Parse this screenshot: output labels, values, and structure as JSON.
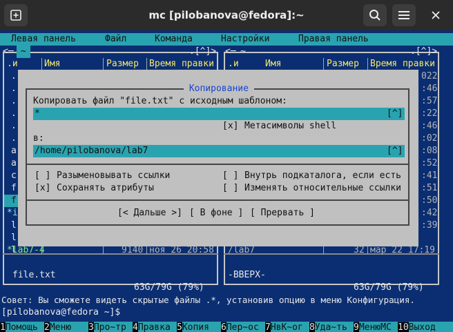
{
  "window": {
    "title": "mc [pilobanova@fedora]:~",
    "new_tab_icon": "new-tab-icon",
    "search_icon": "search-icon",
    "menu_icon": "hamburger-menu-icon",
    "close_icon": "close-icon"
  },
  "menubar": {
    "items": [
      "Левая панель",
      "Файл",
      "Команда",
      "Настройки",
      "Правая панель"
    ]
  },
  "left_panel": {
    "path": "~",
    "top_right": ".[^]>",
    "corner_left": "<─",
    "col_n": ".и",
    "col_name": "Имя",
    "col_size": "Размер",
    "col_mtime": "Время правки",
    "left_chars": [
      ".",
      ".",
      ".",
      ".",
      ".",
      ".",
      "a",
      "a",
      "c",
      "f",
      "f",
      "*i",
      "l",
      "l",
      "l"
    ],
    "last_row": {
      "name": "*lab7-4",
      "size": "9140",
      "mtime": "ноя 26 20:58"
    },
    "mini_status": "file.txt",
    "free_space": "63G/79G (79%)"
  },
  "right_panel": {
    "top_right": ".[^]>",
    "corner_left": "<─",
    "col_n": ".и",
    "col_name": "Имя",
    "col_size": "Размер",
    "col_mtime": "Время правки",
    "right_chars": [
      "022",
      ":46",
      ":57",
      ":22",
      ":46",
      ":02",
      ":08",
      ":52",
      ":41",
      ":51",
      ":50",
      ":42",
      ":39"
    ],
    "last_row": {
      "name": "/lab7",
      "size": "32",
      "mtime": "мар 22 17:19"
    },
    "mini_status": "-ВВЕРХ-",
    "free_space": "63G/79G (79%)"
  },
  "dialog": {
    "title": " Копирование ",
    "prompt": "Копировать файл \"file.txt\" с исходным шаблоном:",
    "source_value": "*",
    "history_btn": "[^]",
    "metachar_check": "[x]",
    "metachar_label": "Метасимволы shell",
    "dest_label": "в:",
    "dest_value": "/home/pilobanova/lab7",
    "opt1_check": "[ ]",
    "opt1_label": "Разыменовывать ссылки",
    "opt2_check": "[x]",
    "opt2_label": "Сохранять атрибуты",
    "opt3_check": "[ ]",
    "opt3_label": "Внутрь подкаталога, если есть",
    "opt4_check": "[ ]",
    "opt4_label": "Изменять относительные ссылки",
    "btn_continue": "[< Дальше >]",
    "btn_background": "[ В фоне ]",
    "btn_abort": "[ Прервать ]"
  },
  "hint": "Совет: Вы сможете видеть скрытые файлы .*, установив опцию в меню Конфигурация.",
  "prompt": "[pilobanova@fedora ~]$",
  "fkeys": [
    {
      "num": "1",
      "label": "Помощь"
    },
    {
      "num": "2",
      "label": "Меню"
    },
    {
      "num": "3",
      "label": "Про~тр"
    },
    {
      "num": "4",
      "label": "Правка"
    },
    {
      "num": "5",
      "label": "Копия"
    },
    {
      "num": "6",
      "label": "Пер~ос"
    },
    {
      "num": "7",
      "label": "НвК~ог"
    },
    {
      "num": "8",
      "label": "Уда~ть"
    },
    {
      "num": "9",
      "label": "МенюMC"
    },
    {
      "num": "10",
      "label": "Выход"
    }
  ],
  "colors": {
    "panel_bg": "#0b2e72",
    "bar_cyan": "#2aa3b0",
    "dialog_gray": "#c0c0c0",
    "highlight_yellow": "#f6e86a"
  }
}
